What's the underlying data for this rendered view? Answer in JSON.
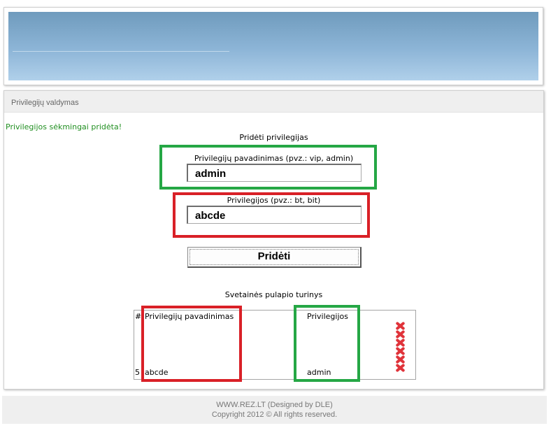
{
  "panel": {
    "title": "Privilegijų valdymas"
  },
  "messages": {
    "success": "Privilegijos sėkmingai pridėta!"
  },
  "form": {
    "heading": "Pridėti privilegijas",
    "name_label": "Privilegijų pavadinimas (pvz.: vip, admin)",
    "name_value": "admin",
    "priv_label": "Privilegijos (pvz.: bt, bit)",
    "priv_value": "abcde",
    "submit_label": "Pridėti"
  },
  "table": {
    "heading": "Svetainės pulapio turinys",
    "columns": [
      "#",
      "Privilegijų pavadinimas",
      "Privilegijos"
    ],
    "rows": [
      {
        "id": "5",
        "name": "abcde",
        "privileges": "admin"
      }
    ],
    "delete_icon": "delete-x-icon"
  },
  "footer": {
    "line1": "WWW.REZ.LT (Designed by DLE)",
    "line2": "Copyright 2012 © All rights reserved."
  },
  "colors": {
    "success_text": "#218f21",
    "annotation_green": "#25a745",
    "annotation_red": "#d92027",
    "banner_blue": "#7ea8c9"
  }
}
